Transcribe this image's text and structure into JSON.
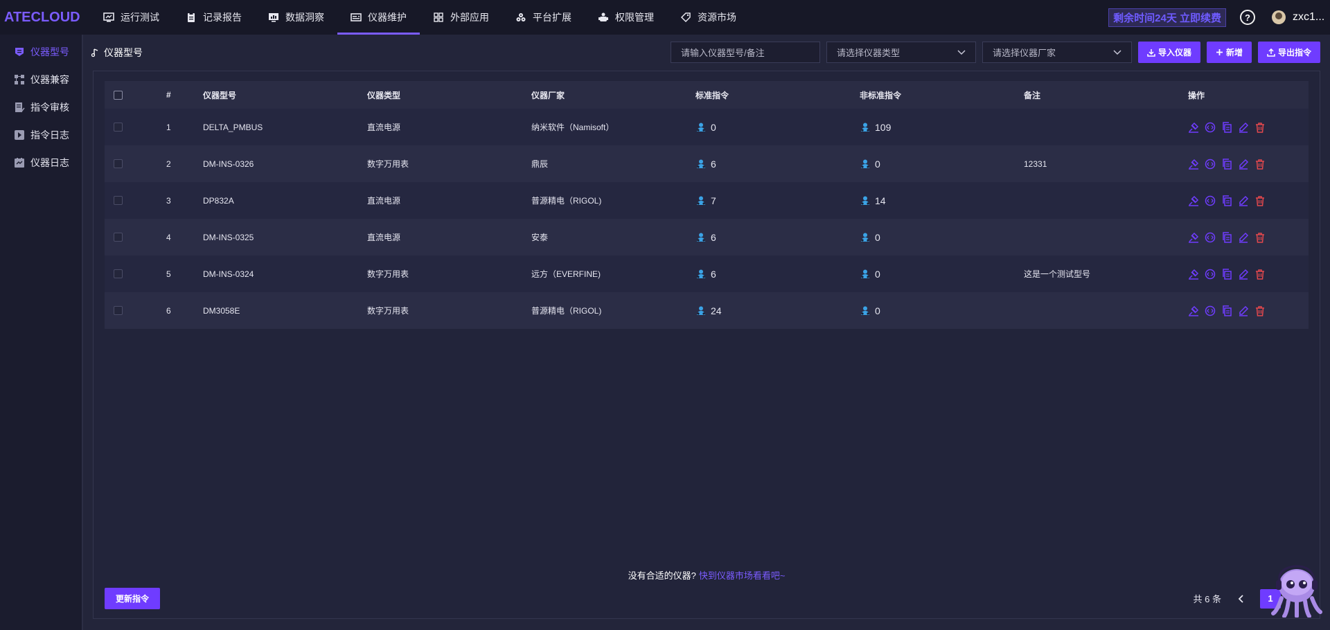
{
  "app": {
    "logo": "ATECLOUD"
  },
  "nav": [
    {
      "label": "运行测试",
      "icon": "monitor-icon"
    },
    {
      "label": "记录报告",
      "icon": "clipboard-icon"
    },
    {
      "label": "数据洞察",
      "icon": "chart-monitor-icon"
    },
    {
      "label": "仪器维护",
      "icon": "instrument-icon",
      "active": true
    },
    {
      "label": "外部应用",
      "icon": "grid-icon"
    },
    {
      "label": "平台扩展",
      "icon": "extension-icon"
    },
    {
      "label": "权限管理",
      "icon": "permission-icon"
    },
    {
      "label": "资源市场",
      "icon": "tag-icon"
    }
  ],
  "header": {
    "trial_text": "剩余时间24天 立即续费",
    "help": "?",
    "username": "zxc1..."
  },
  "sidebar": [
    {
      "label": "仪器型号",
      "active": true
    },
    {
      "label": "仪器兼容"
    },
    {
      "label": "指令审核"
    },
    {
      "label": "指令日志"
    },
    {
      "label": "仪器日志"
    }
  ],
  "breadcrumb": "仪器型号",
  "toolbar": {
    "search_placeholder": "请输入仪器型号/备注",
    "type_placeholder": "请选择仪器类型",
    "vendor_placeholder": "请选择仪器厂家",
    "import_label": "导入仪器",
    "add_label": "新增",
    "export_label": "导出指令"
  },
  "table": {
    "columns": [
      "#",
      "仪器型号",
      "仪器类型",
      "仪器厂家",
      "标准指令",
      "非标准指令",
      "备注",
      "操作"
    ],
    "rows": [
      {
        "no": "1",
        "model": "DELTA_PMBUS",
        "type": "直流电源",
        "vendor": "纳米软件（Namisoft）",
        "std": "0",
        "nonstd": "109",
        "note": ""
      },
      {
        "no": "2",
        "model": "DM-INS-0326",
        "type": "数字万用表",
        "vendor": "鼎辰",
        "std": "6",
        "nonstd": "0",
        "note": "12331"
      },
      {
        "no": "3",
        "model": "DP832A",
        "type": "直流电源",
        "vendor": "普源精电（RIGOL)",
        "std": "7",
        "nonstd": "14",
        "note": ""
      },
      {
        "no": "4",
        "model": "DM-INS-0325",
        "type": "直流电源",
        "vendor": "安泰",
        "std": "6",
        "nonstd": "0",
        "note": ""
      },
      {
        "no": "5",
        "model": "DM-INS-0324",
        "type": "数字万用表",
        "vendor": "远方（EVERFINE)",
        "std": "6",
        "nonstd": "0",
        "note": "这是一个测试型号"
      },
      {
        "no": "6",
        "model": "DM3058E",
        "type": "数字万用表",
        "vendor": "普源精电（RIGOL)",
        "std": "24",
        "nonstd": "0",
        "note": ""
      }
    ]
  },
  "footer": {
    "tip": "没有合适的仪器?",
    "link": "快到仪器市场看看吧~",
    "update_label": "更新指令",
    "total": "共 6 条",
    "page": "1"
  },
  "colors": {
    "accent": "#6f3cff",
    "delete": "#e5484d",
    "count_icon": "#3ba3e6"
  }
}
